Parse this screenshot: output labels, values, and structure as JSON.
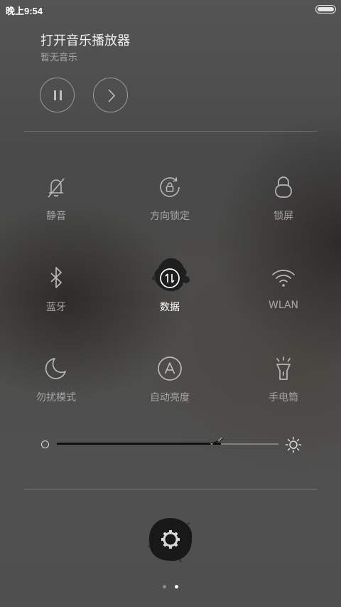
{
  "status_bar": {
    "time": "晚上9:54"
  },
  "music": {
    "title": "打开音乐播放器",
    "subtitle": "暂无音乐"
  },
  "toggles": [
    {
      "label": "静音",
      "icon": "bell-slash-icon",
      "active": false
    },
    {
      "label": "方向锁定",
      "icon": "rotation-lock-icon",
      "active": false
    },
    {
      "label": "锁屏",
      "icon": "lock-icon",
      "active": false
    },
    {
      "label": "蓝牙",
      "icon": "bluetooth-icon",
      "active": false
    },
    {
      "label": "数据",
      "icon": "mobile-data-icon",
      "active": true
    },
    {
      "label": "WLAN",
      "icon": "wifi-icon",
      "active": false
    },
    {
      "label": "勿扰模式",
      "icon": "moon-icon",
      "active": false
    },
    {
      "label": "自动亮度",
      "icon": "auto-brightness-icon",
      "active": false
    },
    {
      "label": "手电筒",
      "icon": "flashlight-icon",
      "active": false
    }
  ],
  "brightness": {
    "level": 0.74
  },
  "pager": {
    "pages": 2,
    "current": 2
  },
  "colors": {
    "active_label": "#ffffff",
    "inactive_label": "#a6a6a6"
  }
}
